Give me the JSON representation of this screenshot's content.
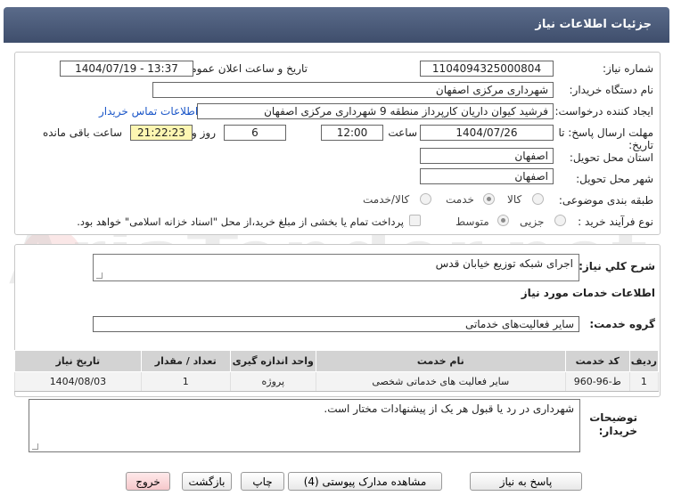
{
  "header": {
    "title": "جزئیات اطلاعات نیاز"
  },
  "info": {
    "need_number_label": "شماره نیاز:",
    "need_number": "1104094325000804",
    "announce_label": "تاریخ و ساعت اعلان عمومی:",
    "announce_value": "1404/07/19 - 13:37",
    "buyer_org_label": "نام دستگاه خریدار:",
    "buyer_org": "شهرداری مرکزی اصفهان",
    "creator_label": "ایجاد کننده درخواست:",
    "creator": "فرشید کیوان داریان کارپرداز منطقه 9 شهرداری مرکزی اصفهان",
    "contact_link": "اطلاعات تماس خریدار",
    "deadline_label": "مهلت ارسال پاسخ: تا تاریخ:",
    "deadline_date": "1404/07/26",
    "time_label": "ساعت",
    "deadline_time": "12:00",
    "days_value": "6",
    "days_label": "روز و",
    "remaining_time": "21:22:23",
    "remaining_label": "ساعت باقی مانده",
    "province_label": "استان محل تحویل:",
    "province": "اصفهان",
    "city_label": "شهر محل تحویل:",
    "city": "اصفهان",
    "category_label": "طبقه بندی موضوعی:",
    "category_options": [
      "کالا",
      "خدمت",
      "کالا/خدمت"
    ],
    "category_selected": "خدمت",
    "purchase_type_label": "نوع فرآیند خرید :",
    "purchase_options": [
      "جزیی",
      "متوسط"
    ],
    "purchase_selected": "متوسط",
    "payment_note": "پرداخت تمام یا بخشی از مبلغ خرید،از محل \"اسناد خزانه اسلامی\" خواهد بود."
  },
  "description": {
    "label": "شرح کلي نياز:",
    "value": "اجرای شبکه توزیع خیابان قدس"
  },
  "services": {
    "section_title": "اطلاعات خدمات مورد نیاز",
    "group_label": "گروه خدمت:",
    "group_value": "سایر فعالیت‌های خدماتی",
    "columns": [
      "ردیف",
      "کد خدمت",
      "نام خدمت",
      "واحد اندازه گیری",
      "تعداد / مقدار",
      "تاریخ نیاز"
    ],
    "rows": [
      [
        "1",
        "ط-96-960",
        "سایر فعالیت های خدماتی شخصی",
        "پروژه",
        "1",
        "1404/08/03"
      ]
    ]
  },
  "buyer_notes": {
    "label": "توضیحات خریدار:",
    "value": "شهرداری در رد یا قبول هر یک از پیشنهادات مختار است."
  },
  "buttons": {
    "reply": "پاسخ به نیاز",
    "attachments": "مشاهده مدارک پیوستی (4)",
    "print": "چاپ",
    "back": "بازگشت",
    "exit": "خروج"
  },
  "watermark": "AriaTender.net",
  "colors": {
    "header": "#4a5a7a",
    "remaining_bg": "#fdf6b2",
    "link": "#1a56c8",
    "exit_btn": "#f6c8cb"
  }
}
